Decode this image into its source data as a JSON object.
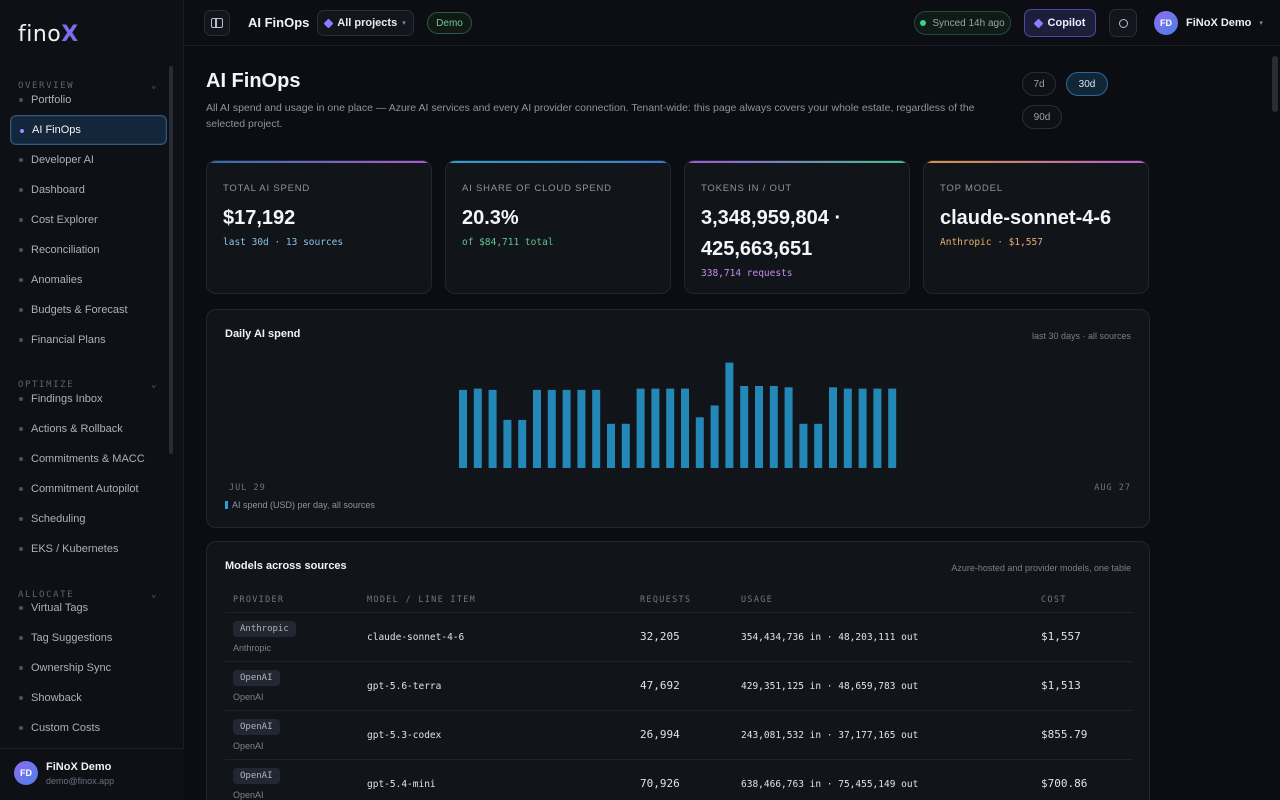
{
  "brand": {
    "name": "fino",
    "mark": "X"
  },
  "sidebar": {
    "sections": [
      {
        "title": "OVERVIEW",
        "items": [
          "Portfolio",
          "AI FinOps",
          "Developer AI",
          "Dashboard",
          "Cost Explorer",
          "Reconciliation",
          "Anomalies",
          "Budgets & Forecast",
          "Financial Plans"
        ]
      },
      {
        "title": "OPTIMIZE",
        "items": [
          "Findings Inbox",
          "Actions & Rollback",
          "Commitments & MACC",
          "Commitment Autopilot",
          "Scheduling",
          "EKS / Kubernetes"
        ]
      },
      {
        "title": "ALLOCATE",
        "items": [
          "Virtual Tags",
          "Tag Suggestions",
          "Ownership Sync",
          "Showback",
          "Custom Costs"
        ]
      }
    ],
    "active_item": "AI FinOps",
    "user": {
      "initials": "FD",
      "name": "FiNoX Demo",
      "email": "demo@finox.app"
    }
  },
  "topbar": {
    "title": "AI FinOps",
    "project": "All projects",
    "badge": "Demo",
    "sync": "Synced 14h ago",
    "copilot": "Copilot",
    "user": {
      "initials": "FD",
      "name": "FiNoX Demo"
    }
  },
  "page": {
    "title": "AI FinOps",
    "description": "All AI spend and usage in one place — Azure AI services and every AI provider connection. Tenant-wide: this page always covers your whole estate, regardless of the selected project.",
    "ranges": [
      "7d",
      "30d",
      "90d"
    ],
    "active_range": "30d"
  },
  "kpis": [
    {
      "label": "TOTAL AI SPEND",
      "value": "$17,192",
      "sub": "last 30d · 13 sources",
      "accent": "#3b82c4"
    },
    {
      "label": "AI SHARE OF CLOUD SPEND",
      "value": "20.3%",
      "sub": "of $84,711 total",
      "accent": "#2f9fd0"
    },
    {
      "label": "TOKENS IN / OUT",
      "value": "3,348,959,804 · 425,663,651",
      "sub": "338,714 requests",
      "accent": "#a855f7"
    },
    {
      "label": "TOP MODEL",
      "value": "claude-sonnet-4-6",
      "sub": "Anthropic · $1,557",
      "accent": "#e08a3c"
    }
  ],
  "colors": {
    "kpi_bars": [
      "linear-gradient(90deg,#2d6fb0,#b05ad8)",
      "linear-gradient(90deg,#2aa0d0,#3a7bd0)",
      "linear-gradient(90deg,#a054e0,#3fc48a)",
      "linear-gradient(90deg,#e0923a,#c05ad0)"
    ],
    "kpi_subs": [
      "#8cc4e8",
      "#5fc48f",
      "#c58af0",
      "#e8b06a"
    ],
    "bar": "#2387b8"
  },
  "chart_panel": {
    "title": "Daily AI spend",
    "note": "last 30 days · all sources",
    "x_start": "JUL 29",
    "x_end": "AUG 27",
    "legend": "AI spend (USD) per day, all sources"
  },
  "chart_data": {
    "type": "bar",
    "title": "Daily AI spend",
    "ylabel": "AI spend (USD) per day, all sources",
    "categories": [
      "JUL 29",
      "",
      "",
      "",
      "",
      "",
      "",
      "",
      "",
      "",
      "",
      "",
      "",
      "",
      "",
      "",
      "",
      "",
      "",
      "",
      "",
      "",
      "",
      "",
      "",
      "",
      "",
      "",
      "",
      "AUG 27"
    ],
    "values": [
      600,
      610,
      600,
      370,
      370,
      600,
      600,
      600,
      600,
      600,
      340,
      340,
      610,
      610,
      610,
      610,
      390,
      480,
      810,
      630,
      630,
      630,
      620,
      340,
      340,
      620,
      610,
      610,
      610,
      610
    ],
    "ylim": [
      0,
      830
    ],
    "grid": false
  },
  "models_table": {
    "title": "Models across sources",
    "note": "Azure-hosted and provider models, one table",
    "columns": [
      "PROVIDER",
      "MODEL / LINE ITEM",
      "REQUESTS",
      "USAGE",
      "COST"
    ],
    "rows": [
      {
        "chip": "Anthropic",
        "provider": "Anthropic",
        "model": "claude-sonnet-4-6",
        "requests": "32,205",
        "usage": "354,434,736 in · 48,203,111 out",
        "cost": "$1,557"
      },
      {
        "chip": "OpenAI",
        "provider": "OpenAI",
        "model": "gpt-5.6-terra",
        "requests": "47,692",
        "usage": "429,351,125 in · 48,659,783 out",
        "cost": "$1,513"
      },
      {
        "chip": "OpenAI",
        "provider": "OpenAI",
        "model": "gpt-5.3-codex",
        "requests": "26,994",
        "usage": "243,081,532 in · 37,177,165 out",
        "cost": "$855.79"
      },
      {
        "chip": "OpenAI",
        "provider": "OpenAI",
        "model": "gpt-5.4-mini",
        "requests": "70,926",
        "usage": "638,466,763 in · 75,455,149 out",
        "cost": "$700.86"
      }
    ]
  }
}
